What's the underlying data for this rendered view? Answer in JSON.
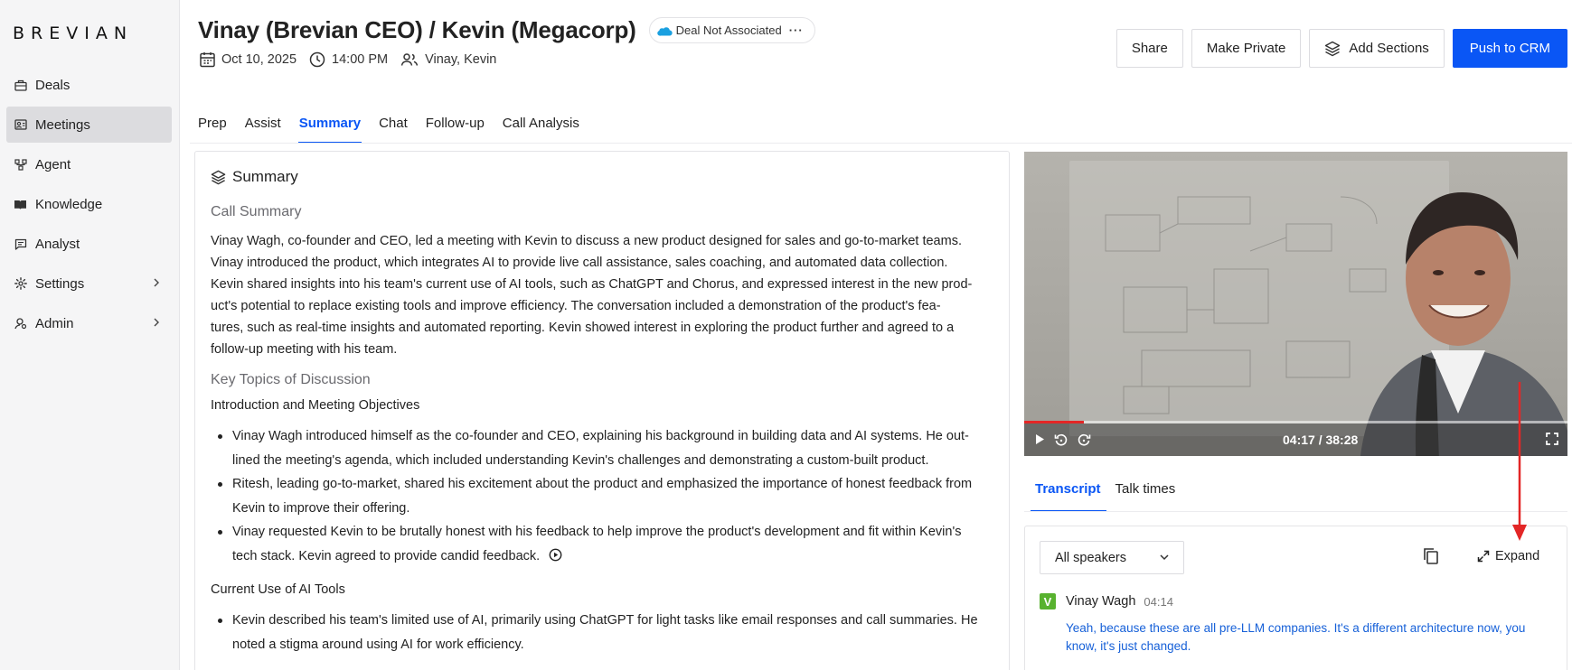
{
  "app": {
    "logo": "BREVIAN"
  },
  "sidebar": {
    "items": [
      {
        "label": "Deals",
        "icon": "briefcase-icon"
      },
      {
        "label": "Meetings",
        "icon": "meetings-icon",
        "active": true
      },
      {
        "label": "Agent",
        "icon": "agent-icon"
      },
      {
        "label": "Knowledge",
        "icon": "book-icon"
      },
      {
        "label": "Analyst",
        "icon": "chat-icon"
      },
      {
        "label": "Settings",
        "icon": "gear-icon",
        "expandable": true
      },
      {
        "label": "Admin",
        "icon": "admin-icon",
        "expandable": true
      }
    ]
  },
  "header": {
    "title": "Vinay (Brevian CEO) / Kevin (Megacorp)",
    "deal_badge": "Deal Not Associated",
    "deal_badge_more": "···",
    "date": "Oct 10, 2025",
    "time": "14:00 PM",
    "attendees": "Vinay, Kevin"
  },
  "actions": {
    "share": "Share",
    "make_private": "Make Private",
    "add_sections": "Add Sections",
    "push_crm": "Push to CRM"
  },
  "tabs": [
    "Prep",
    "Assist",
    "Summary",
    "Chat",
    "Follow-up",
    "Call Analysis"
  ],
  "active_tab": "Summary",
  "summary": {
    "heading": "Summary",
    "call_summary_heading": "Call Summary",
    "call_summary": [
      "Vinay Wagh, co-founder and CEO, led a meeting with Kevin to discuss a new product designed for sales and go-to-market teams.",
      "Vinay introduced the product, which integrates AI to provide live call assistance, sales coaching, and automated data collection.",
      "Kevin shared insights into his team's current use of AI tools, such as ChatGPT and Chorus, and expressed interest in the new prod-",
      "uct's potential to replace existing tools and improve efficiency. The conversation included a demonstration of the product's fea-",
      "tures, such as real-time insights and automated reporting. Kevin showed interest in exploring the product further and agreed to a",
      "follow-up meeting with his team."
    ],
    "key_topics_heading": "Key Topics of Discussion",
    "topic1_title": "Introduction and Meeting Objectives",
    "topic1_bullets": [
      [
        "Vinay Wagh introduced himself as the co-founder and CEO, explaining his background in building data and AI systems. He out-",
        "lined the meeting's agenda, which included understanding Kevin's challenges and demonstrating a custom-built product."
      ],
      [
        "Ritesh, leading go-to-market, shared his excitement about the product and emphasized the importance of honest feedback from",
        "Kevin to improve their offering."
      ],
      [
        "Vinay requested Kevin to be brutally honest with his feedback to help improve the product's development and fit within Kevin's",
        "tech stack. Kevin agreed to provide candid feedback."
      ]
    ],
    "topic2_title": "Current Use of AI Tools",
    "topic2_bullets": [
      [
        "Kevin described his team's limited use of AI, primarily using ChatGPT for light tasks like email responses and call summaries. He",
        "noted a stigma around using AI for work efficiency."
      ]
    ]
  },
  "video": {
    "time_display": "04:17 / 38:28",
    "progress_fraction": 0.109
  },
  "transcript": {
    "tabs": [
      "Transcript",
      "Talk times"
    ],
    "active_tab": "Transcript",
    "speaker_filter": "All speakers",
    "expand_label": "Expand",
    "entries": [
      {
        "avatar": "V",
        "speaker": "Vinay Wagh",
        "timestamp": "04:14",
        "text_lines": [
          "Yeah, because these are all pre-LLM companies. It's a different architecture now, you",
          "know, it's just changed."
        ]
      }
    ]
  },
  "colors": {
    "accent": "#0a56f5",
    "annotation": "#e32626",
    "avatar": "#58b22f"
  }
}
